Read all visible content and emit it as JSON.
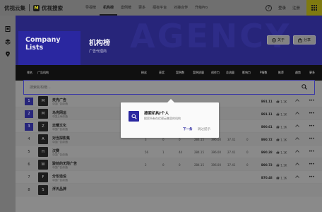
{
  "brand": {
    "name1": "优视云集",
    "name2": "优视搜索",
    "logo_mark": "M"
  },
  "nav": {
    "items": [
      "导视榜",
      "机构榜",
      "案例榜",
      "更多",
      "招标平台",
      "对接合作",
      "升级Pro"
    ],
    "active_index": 1,
    "right": {
      "help_icon": "?",
      "login": "登录",
      "register": "注册"
    }
  },
  "rail": {
    "icons": [
      "bookmark-icon",
      "layers-icon",
      "pin-icon"
    ]
  },
  "hero": {
    "watermark": "AGENCY",
    "title_en": "Company\nLists",
    "title_cn": "机构榜",
    "subtitle_cn": "广告代理商",
    "about_button": "关于",
    "share_button": "分享"
  },
  "table": {
    "headers": [
      "排名",
      "广告机构",
      "粉丝",
      "获奖",
      "案例数",
      "案例质量",
      "创作力",
      "总流量",
      "影响力",
      "P指数",
      "推荐",
      "趋势",
      "更多"
    ],
    "search_placeholder": "搜索机构榜..."
  },
  "rows": [
    {
      "rank": "1",
      "top": true,
      "logo": "M",
      "name": "麦壳广告",
      "tag": "中国广告/制造",
      "fans": "",
      "awards": "",
      "cases": "",
      "quality": "",
      "creativity": "",
      "traffic": "",
      "influence": "",
      "pindex": "B91.11",
      "likes": "1.1K"
    },
    {
      "rank": "2",
      "top": true,
      "logo": "M",
      "name": "马克网运",
      "tag": "中国上海/制造",
      "fans": "",
      "awards": "",
      "cases": "",
      "quality": "",
      "creativity": "",
      "traffic": "",
      "influence": "",
      "pindex": "B91.11",
      "likes": "1.1K"
    },
    {
      "rank": "3",
      "top": true,
      "logo": "Z",
      "name": "志耀文化",
      "tag": "中国广告/制造",
      "fans": "",
      "awards": "",
      "cases": "",
      "quality": "",
      "creativity": "",
      "traffic": "",
      "influence": "",
      "pindex": "B90.61",
      "likes": "1.1K"
    },
    {
      "rank": "4",
      "top": false,
      "logo": "A",
      "name": "对当探影集",
      "tag": "中国广告/制造",
      "fans": "3",
      "awards": "0",
      "cases": "0",
      "quality": "284.15",
      "creativity": "396.00",
      "traffic": "37.41",
      "influence": "0",
      "pindex": "B90.72",
      "likes": "1.1K"
    },
    {
      "rank": "5",
      "top": false,
      "logo": "H",
      "name": "汉赛",
      "tag": "中国广告/制造",
      "fans": "56",
      "awards": "1",
      "cases": "44",
      "quality": "284.15",
      "creativity": "396.00",
      "traffic": "27.41",
      "influence": "0",
      "pindex": "B90.28",
      "likes": "1.1K"
    },
    {
      "rank": "6",
      "top": false,
      "logo": "W",
      "name": "骏前的无限广告",
      "tag": "中国广告/制造",
      "fans": "2",
      "awards": "0",
      "cases": "0",
      "quality": "284.15",
      "creativity": "396.00",
      "traffic": "37.41",
      "influence": "0",
      "pindex": "B90.72",
      "likes": "1.1K"
    },
    {
      "rank": "7",
      "top": false,
      "logo": "F",
      "name": "分形造设",
      "tag": "中国广告/制造",
      "fans": "",
      "awards": "",
      "cases": "",
      "quality": "",
      "creativity": "",
      "traffic": "",
      "influence": "",
      "pindex": "B70.48",
      "likes": "1.1K"
    },
    {
      "rank": "8",
      "top": false,
      "logo": "S",
      "name": "浮天品牌",
      "tag": "",
      "fans": "",
      "awards": "",
      "cases": "",
      "quality": "",
      "creativity": "",
      "traffic": "",
      "influence": "",
      "pindex": "",
      "likes": ""
    }
  ],
  "popup": {
    "icon": "search-icon",
    "title": "搜索机构/个人",
    "desc": "搜索所有在优视云集里的机构",
    "next": "下一条",
    "skip": "跳过提示"
  }
}
